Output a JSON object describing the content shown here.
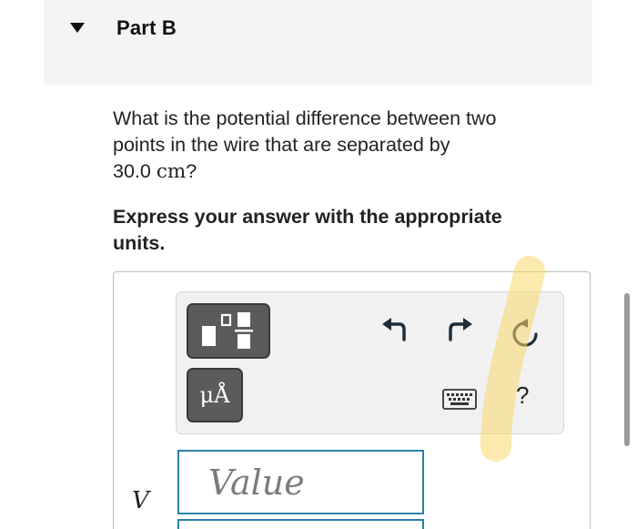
{
  "part": {
    "title": "Part B",
    "toggle_icon": "caret-down-icon"
  },
  "question": {
    "line1": "What is the potential difference between two",
    "line2": "points in the wire that are separated by",
    "value": "30.0",
    "unit": "cm",
    "suffix": "?"
  },
  "instruction": {
    "line1": "Express your answer with the appropriate",
    "line2": "units."
  },
  "toolbar": {
    "templates_icon": "templates-icon",
    "units_label": "μÅ",
    "undo_icon": "undo-icon",
    "redo_icon": "redo-icon",
    "reset_icon": "reset-icon",
    "keyboard_icon": "keyboard-icon",
    "help_label": "?"
  },
  "answer": {
    "variable": "V",
    "value_placeholder": "Value",
    "value": ""
  },
  "colors": {
    "input_border": "#2c7fa8",
    "button_bg": "#5b5b5b",
    "highlighter": "#f7d76a"
  }
}
